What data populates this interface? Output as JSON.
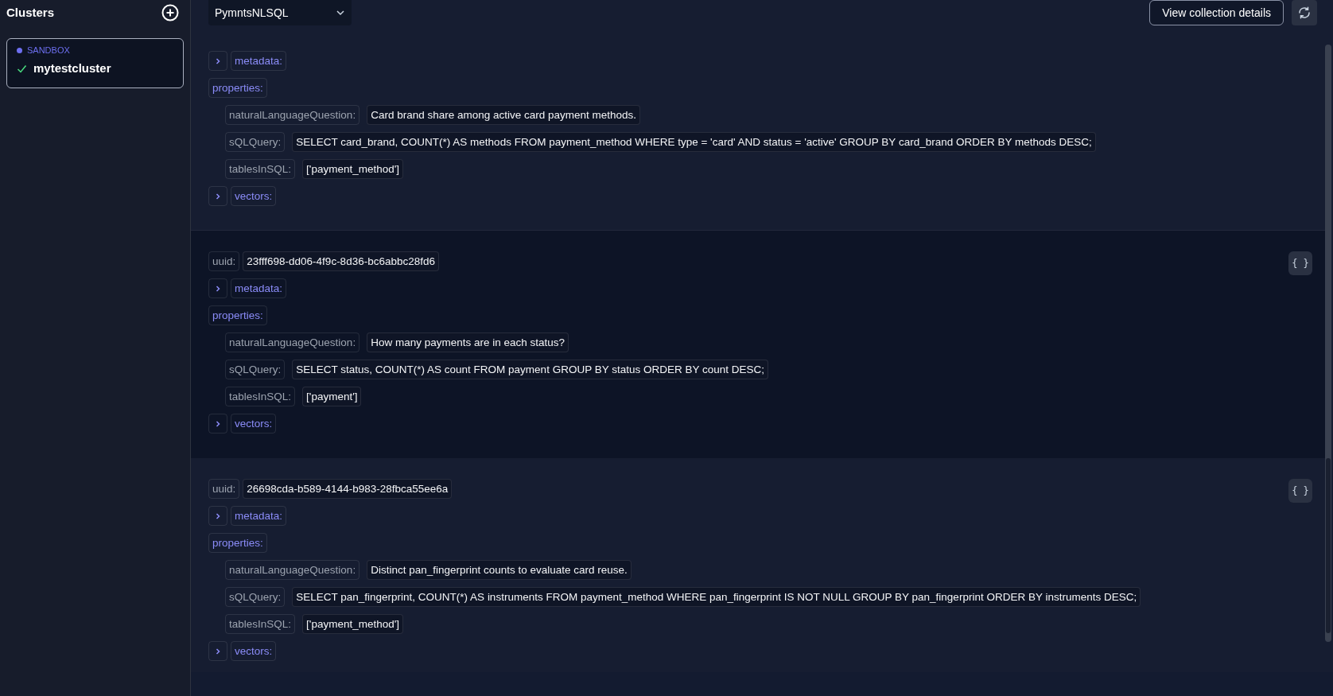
{
  "sidebar": {
    "title": "Clusters",
    "cluster": {
      "tag": "SANDBOX",
      "name": "mytestcluster",
      "connected": true,
      "selected": true
    }
  },
  "toolbar": {
    "collection": "PymntsNLSQL",
    "details_button": "View collection details"
  },
  "records": [
    {
      "metadata": {
        "label": "metadata:",
        "expanded": false
      },
      "properties_label": "properties:",
      "properties": [
        {
          "key": "naturalLanguageQuestion:",
          "value": "Card brand share among active card payment methods."
        },
        {
          "key": "sQLQuery:",
          "value": "SELECT card_brand, COUNT(*) AS methods FROM payment_method WHERE type = 'card' AND status = 'active' GROUP BY card_brand ORDER BY methods DESC;"
        },
        {
          "key": "tablesInSQL:",
          "value": "['payment_method']"
        }
      ],
      "vectors": {
        "label": "vectors:",
        "expanded": false
      }
    },
    {
      "uuid_key": "uuid:",
      "uuid": "23fff698-dd06-4f9c-8d36-bc6abbc28fd6",
      "json_button": "{ }",
      "metadata": {
        "label": "metadata:",
        "expanded": false
      },
      "properties_label": "properties:",
      "properties": [
        {
          "key": "naturalLanguageQuestion:",
          "value": "How many payments are in each status?"
        },
        {
          "key": "sQLQuery:",
          "value": "SELECT status, COUNT(*) AS count FROM payment GROUP BY status ORDER BY count DESC;"
        },
        {
          "key": "tablesInSQL:",
          "value": "['payment']"
        }
      ],
      "vectors": {
        "label": "vectors:",
        "expanded": false
      }
    },
    {
      "uuid_key": "uuid:",
      "uuid": "26698cda-b589-4144-b983-28fbca55ee6a",
      "json_button": "{ }",
      "metadata": {
        "label": "metadata:",
        "expanded": false
      },
      "properties_label": "properties:",
      "properties": [
        {
          "key": "naturalLanguageQuestion:",
          "value": "Distinct pan_fingerprint counts to evaluate card reuse."
        },
        {
          "key": "sQLQuery:",
          "value": "SELECT pan_fingerprint, COUNT(*) AS instruments FROM payment_method WHERE pan_fingerprint IS NOT NULL GROUP BY pan_fingerprint ORDER BY instruments DESC;"
        },
        {
          "key": "tablesInSQL:",
          "value": "['payment_method']"
        }
      ],
      "vectors": {
        "label": "vectors:",
        "expanded": false
      }
    }
  ]
}
